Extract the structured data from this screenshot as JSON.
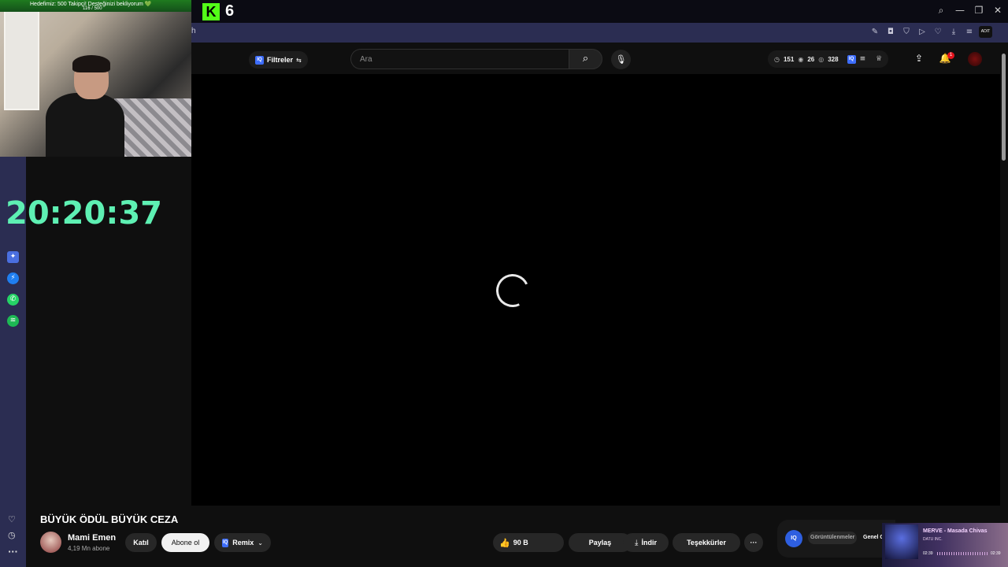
{
  "browser": {
    "tab_logo_letter": "K",
    "tab_count": "6",
    "toolbar_partial_text": "h",
    "window_controls": [
      "search-icon",
      "minimize-icon",
      "restore-icon",
      "close-icon"
    ],
    "toolbar_icons": [
      "edit-icon",
      "camera-icon",
      "shield-icon",
      "play-icon",
      "heart-icon",
      "download-icon",
      "menu-icon"
    ],
    "toolbar_avatar_text": "ADIT"
  },
  "overlay": {
    "banner_text": "Hedefimiz: 500 Takipçi! Desteğinizi bekliyorum 💚",
    "banner_count": "116 / 500",
    "clock": "20:20:37"
  },
  "side_strip": {
    "icons": [
      "app-icon",
      "messenger-icon",
      "whatsapp-icon",
      "spotify-icon"
    ],
    "bottom_icons": [
      "heart-icon",
      "clock-icon",
      "more-icon"
    ]
  },
  "header": {
    "filters_label": "Filtreler",
    "iq_badge": "IQ",
    "search_placeholder": "Ara",
    "stats": {
      "watch": "151",
      "views": "26",
      "total": "328"
    },
    "notifications_count": "1"
  },
  "video": {
    "title": "BÜYÜK ÖDÜL BÜYÜK CEZA",
    "channel_name": "Mami Emen",
    "channel_subs": "4,19 Mn abone",
    "join_label": "Katıl",
    "subscribe_label": "Abone ol",
    "remix_label": "Remix",
    "like_count": "90 B",
    "share_label": "Paylaş",
    "download_label": "İndir",
    "thanks_label": "Teşekkürler",
    "more_label": "···"
  },
  "iq_panel": {
    "badge": "IQ",
    "tab_views": "Görüntülenmeler",
    "tab_general": "Genel G"
  },
  "spotify": {
    "title": "MERVE - Masada Chivas",
    "artist": "DATU INC.",
    "time_elapsed": "02:39",
    "time_total": "02:39"
  },
  "colors": {
    "kick_green": "#53fc18",
    "clock_green": "#5ef0b3",
    "toolbar_bg": "#2b2d52",
    "notification_red": "#e3141e",
    "iq_blue": "#3d6dfc"
  }
}
